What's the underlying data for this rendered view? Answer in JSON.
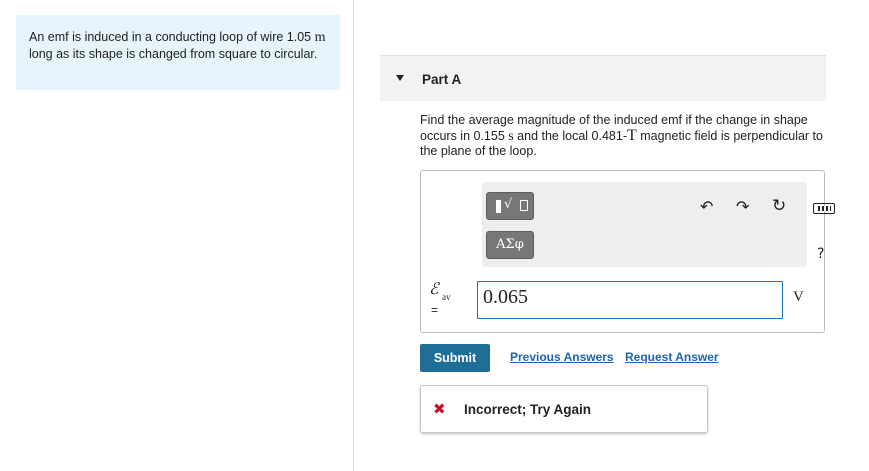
{
  "problem": {
    "text_part1": "An emf is induced in a conducting loop of wire 1.05 ",
    "unit_m": "m",
    "text_part2": " long as its shape is changed from square to circular."
  },
  "part": {
    "title": "Part A"
  },
  "question": {
    "part1": "Find the average magnitude of the induced emf if the change in shape occurs in 0.155 ",
    "unit_s": "s",
    "part2": " and the local 0.481-",
    "unit_T": "T",
    "part3": " magnetic field is perpendicular to the plane of the loop."
  },
  "toolbar": {
    "greek_label": "ΑΣφ",
    "help_label": "?",
    "icons": [
      "templates-icon",
      "undo-icon",
      "redo-icon",
      "reset-icon",
      "keyboard-icon",
      "help-icon"
    ]
  },
  "answer": {
    "symbol": "ℰ",
    "subscript": "av",
    "equals": "=",
    "value": "0.065",
    "unit": "V"
  },
  "actions": {
    "submit_label": "Submit",
    "previous_answers_label": "Previous Answers",
    "request_answer_label": "Request Answer"
  },
  "feedback": {
    "text": "Incorrect; Try Again",
    "color": "#c8102e"
  },
  "colors": {
    "problem_bg": "#e8f4fb",
    "submit_bg": "#1e6e98",
    "link": "#1f64ad"
  }
}
